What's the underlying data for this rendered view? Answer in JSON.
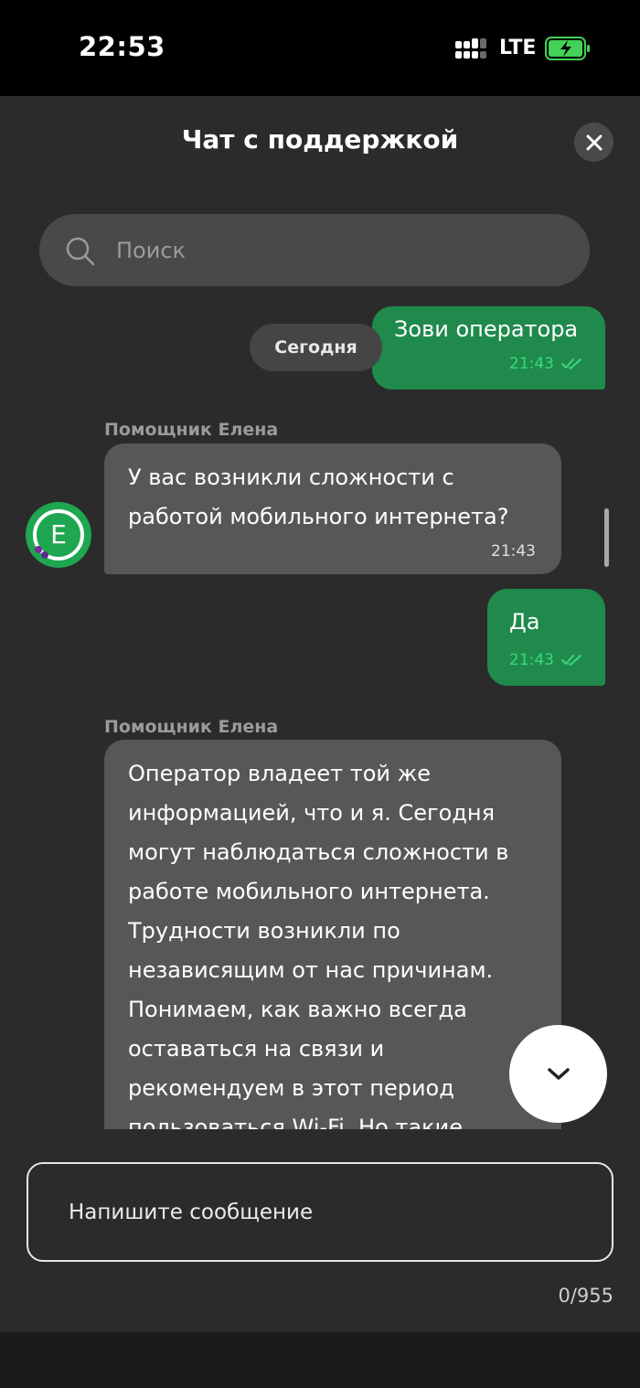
{
  "status_bar": {
    "time": "22:53",
    "network": "LTE",
    "battery_state": "charging",
    "battery_color": "#43d158",
    "icons": [
      "signal-icon",
      "battery-charging-icon"
    ]
  },
  "header": {
    "title": "Чат с поддержкой",
    "close_icon": "close-icon"
  },
  "search": {
    "placeholder": "Поиск",
    "icon": "search-icon"
  },
  "chat": {
    "date_separator": "Сегодня",
    "messages": [
      {
        "direction": "out",
        "text": "Зови оператора",
        "time": "21:43",
        "status": "read"
      },
      {
        "direction": "in",
        "sender": "Помощник Елена",
        "lines": [
          "У вас возникли сложности с",
          "работой мобильного интернета?"
        ],
        "time": "21:43"
      },
      {
        "direction": "out",
        "text": "Да",
        "time": "21:43",
        "status": "read"
      },
      {
        "direction": "in",
        "sender": "Помощник Елена",
        "lines": [
          "Оператор владеет той же",
          "информацией, что и я. Сегодня",
          "могут наблюдаться сложности в",
          "работе мобильного интернета.",
          "Трудности возникли по",
          "независящим от нас причинам.",
          "Понимаем, как важно всегда",
          "оставаться на связи и",
          "рекомендуем в этот период",
          "пользоваться Wi-Fi. Но такие"
        ]
      }
    ],
    "avatar_letter": "E",
    "avatar_color": "#1fa650"
  },
  "composer": {
    "placeholder": "Напишите сообщение",
    "counter": "0/955"
  },
  "colors": {
    "outgoing_bubble": "#1f8a4c",
    "incoming_bubble": "#575757",
    "background": "#2b2b2b",
    "read_check": "#3ad97a"
  }
}
